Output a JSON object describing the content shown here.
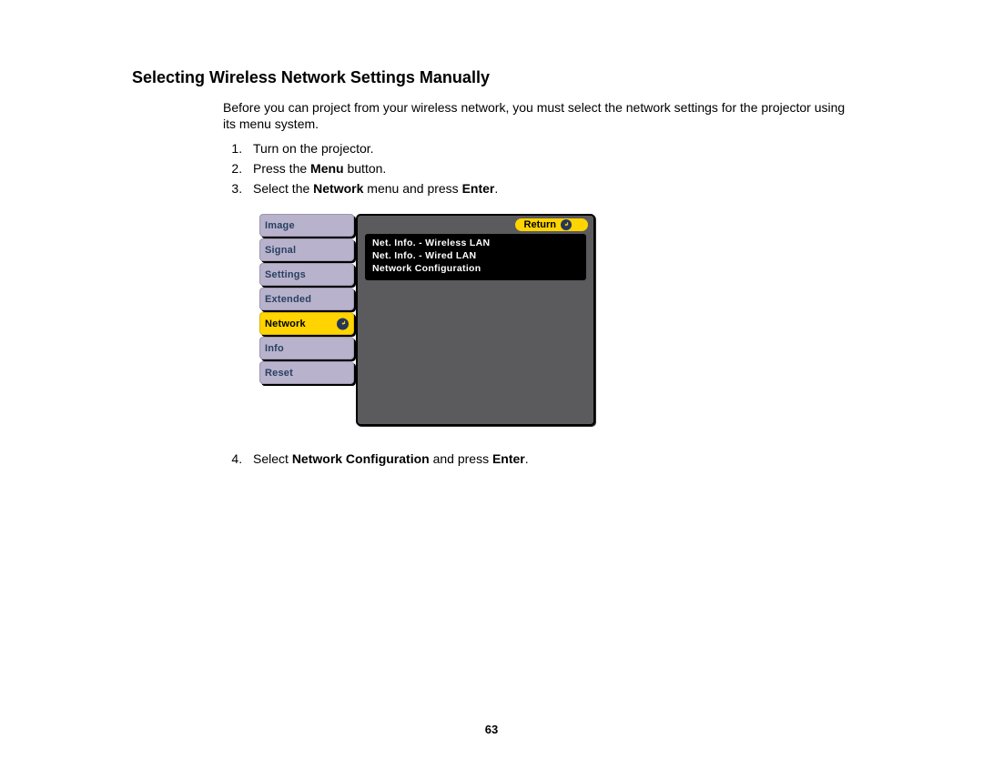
{
  "heading": "Selecting Wireless Network Settings Manually",
  "intro": "Before you can project from your wireless network, you must select the network settings for the projector using its menu system.",
  "steps": {
    "s1": "Turn on the projector.",
    "s2_a": "Press the ",
    "s2_b": "Menu",
    "s2_c": " button.",
    "s3_a": "Select the ",
    "s3_b": "Network",
    "s3_c": " menu and press ",
    "s3_d": "Enter",
    "s3_e": ".",
    "s4_a": "Select ",
    "s4_b": "Network Configuration",
    "s4_c": " and press ",
    "s4_d": "Enter",
    "s4_e": "."
  },
  "sidebar": {
    "items": [
      {
        "label": "Image",
        "selected": false
      },
      {
        "label": "Signal",
        "selected": false
      },
      {
        "label": "Settings",
        "selected": false
      },
      {
        "label": "Extended",
        "selected": false
      },
      {
        "label": "Network",
        "selected": true
      },
      {
        "label": "Info",
        "selected": false
      },
      {
        "label": "Reset",
        "selected": false
      }
    ]
  },
  "panel": {
    "return": "Return",
    "menu": [
      "Net. Info. - Wireless LAN",
      "Net. Info. - Wired LAN",
      "Network Configuration"
    ]
  },
  "page_number": "63"
}
